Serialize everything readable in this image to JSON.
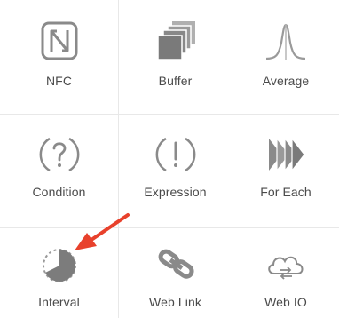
{
  "tiles": [
    {
      "label": "NFC",
      "icon": "nfc-icon"
    },
    {
      "label": "Buffer",
      "icon": "buffer-stack-icon"
    },
    {
      "label": "Average",
      "icon": "bell-curve-icon"
    },
    {
      "label": "Condition",
      "icon": "question-circle-icon"
    },
    {
      "label": "Expression",
      "icon": "exclamation-circle-icon"
    },
    {
      "label": "For Each",
      "icon": "chevrons-right-icon"
    },
    {
      "label": "Interval",
      "icon": "interval-timer-icon"
    },
    {
      "label": "Web Link",
      "icon": "link-chain-icon"
    },
    {
      "label": "Web IO",
      "icon": "cloud-sync-icon"
    }
  ],
  "colors": {
    "icon_gray": "#8a8a8a",
    "icon_light": "#b5b5b5",
    "label_text": "#4a4a4a",
    "divider": "#e8e8e8",
    "arrow_red": "#e8412c"
  }
}
